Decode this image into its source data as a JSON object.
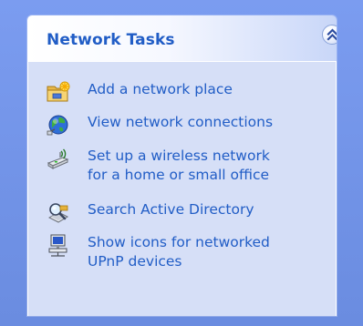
{
  "panel": {
    "title": "Network Tasks",
    "collapse_icon": "chevron-double-up-icon",
    "colors": {
      "title_blue": "#215dc6",
      "link_blue": "#215dc6",
      "body_bg": "#d6dff7",
      "pane_bg": "#6f8fe0"
    }
  },
  "tasks": [
    {
      "icon": "network-place-folder-icon",
      "lines": [
        "Add a network place"
      ]
    },
    {
      "icon": "network-globe-icon",
      "lines": [
        "View network connections"
      ]
    },
    {
      "icon": "wireless-network-icon",
      "lines": [
        "Set up a wireless network",
        "for a home or small office"
      ]
    },
    {
      "icon": "search-directory-icon",
      "lines": [
        "Search Active Directory"
      ]
    },
    {
      "icon": "upnp-device-icon",
      "lines": [
        "Show icons for networked",
        "UPnP devices"
      ]
    }
  ]
}
